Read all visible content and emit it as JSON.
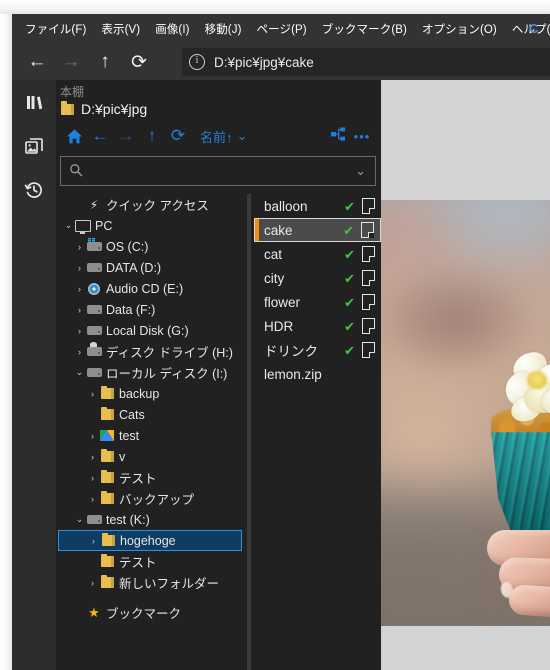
{
  "window": {
    "menu": [
      {
        "label": "ファイル(F)",
        "mnemonic": "F"
      },
      {
        "label": "表示(V)",
        "mnemonic": "V"
      },
      {
        "label": "画像(I)",
        "mnemonic": "I"
      },
      {
        "label": "移動(J)",
        "mnemonic": "J"
      },
      {
        "label": "ページ(P)",
        "mnemonic": "P"
      },
      {
        "label": "ブックマーク(B)",
        "mnemonic": "B"
      },
      {
        "label": "オプション(O)",
        "mnemonic": "O"
      },
      {
        "label": "ヘルプ(H)",
        "mnemonic": "H"
      }
    ],
    "logo_text": "C"
  },
  "addressbar": {
    "back_icon": "arrow-left-icon",
    "forward_icon": "arrow-right-icon",
    "up_icon": "arrow-up-icon",
    "reload_icon": "reload-icon",
    "info_icon": "info-icon",
    "path": "D:¥pic¥jpg¥cake",
    "back_glyph": "←",
    "forward_glyph": "→",
    "up_glyph": "↑",
    "reload_glyph": "⟳",
    "info_glyph": "i"
  },
  "rail": {
    "items": [
      {
        "name": "library-icon",
        "title": "本棚"
      },
      {
        "name": "images-icon",
        "title": "画像"
      },
      {
        "name": "history-icon",
        "title": "履歴"
      }
    ]
  },
  "browser": {
    "panel_title": "本棚",
    "breadcrumb": "D:¥pic¥jpg",
    "toolbar": {
      "home_glyph": "⌂",
      "back_glyph": "←",
      "forward_glyph": "→",
      "up_glyph": "↑",
      "refresh_glyph": "⟳",
      "sort_label": "名前↑",
      "sort_chevron": "⌄",
      "share_glyph": "⛗",
      "more_glyph": "•••"
    },
    "search": {
      "placeholder": "",
      "value": "",
      "magnifier_glyph": "⌕",
      "chevron_glyph": "⌄"
    },
    "tree": [
      {
        "label": "クイック アクセス",
        "icon": "bolt",
        "indent": 1,
        "twisty": "",
        "selected": false
      },
      {
        "label": "PC",
        "icon": "monitor",
        "indent": 0,
        "twisty": "⌄",
        "selected": false
      },
      {
        "label": "OS (C:)",
        "icon": "drive-os",
        "indent": 1,
        "twisty": "›",
        "selected": false
      },
      {
        "label": "DATA (D:)",
        "icon": "drive",
        "indent": 1,
        "twisty": "›",
        "selected": false
      },
      {
        "label": "Audio CD (E:)",
        "icon": "cd",
        "indent": 1,
        "twisty": "›",
        "selected": false
      },
      {
        "label": "Data (F:)",
        "icon": "drive",
        "indent": 1,
        "twisty": "›",
        "selected": false
      },
      {
        "label": "Local Disk (G:)",
        "icon": "drive",
        "indent": 1,
        "twisty": "›",
        "selected": false
      },
      {
        "label": "ディスク ドライブ (H:)",
        "icon": "drive-removable",
        "indent": 1,
        "twisty": "›",
        "selected": false
      },
      {
        "label": "ローカル ディスク (I:)",
        "icon": "drive",
        "indent": 1,
        "twisty": "⌄",
        "selected": false
      },
      {
        "label": "backup",
        "icon": "folder",
        "indent": 2,
        "twisty": "›",
        "selected": false
      },
      {
        "label": "Cats",
        "icon": "folder",
        "indent": 2,
        "twisty": "",
        "selected": false
      },
      {
        "label": "test",
        "icon": "gdrive",
        "indent": 2,
        "twisty": "›",
        "selected": false
      },
      {
        "label": "v",
        "icon": "folder",
        "indent": 2,
        "twisty": "›",
        "selected": false
      },
      {
        "label": "テスト",
        "icon": "folder",
        "indent": 2,
        "twisty": "›",
        "selected": false
      },
      {
        "label": "バックアップ",
        "icon": "folder",
        "indent": 2,
        "twisty": "›",
        "selected": false
      },
      {
        "label": "test (K:)",
        "icon": "drive",
        "indent": 1,
        "twisty": "⌄",
        "selected": false
      },
      {
        "label": "hogehoge",
        "icon": "folder",
        "indent": 2,
        "twisty": "›",
        "selected": true
      },
      {
        "label": "テスト",
        "icon": "folder",
        "indent": 2,
        "twisty": "",
        "selected": false
      },
      {
        "label": "新しいフォルダー",
        "icon": "folder",
        "indent": 2,
        "twisty": "›",
        "selected": false
      },
      {
        "label": "ブックマーク",
        "icon": "star",
        "indent": 1,
        "twisty": "",
        "selected": false
      }
    ],
    "files": [
      {
        "name": "balloon",
        "checked": true,
        "doc": true,
        "selected": false
      },
      {
        "name": "cake",
        "checked": true,
        "doc": true,
        "selected": true
      },
      {
        "name": "cat",
        "checked": true,
        "doc": true,
        "selected": false
      },
      {
        "name": "city",
        "checked": true,
        "doc": true,
        "selected": false
      },
      {
        "name": "flower",
        "checked": true,
        "doc": true,
        "selected": false
      },
      {
        "name": "HDR",
        "checked": true,
        "doc": true,
        "selected": false
      },
      {
        "name": "ドリンク",
        "checked": true,
        "doc": true,
        "selected": false
      },
      {
        "name": "lemon.zip",
        "checked": false,
        "doc": false,
        "selected": false
      }
    ],
    "check_glyph": "✔"
  },
  "viewer": {
    "alt": "cupcake-photo"
  },
  "colors": {
    "window_chrome": "#333333",
    "panel_bg": "#212121",
    "rail_bg": "#2d2d2d",
    "accent_blue": "#1f7fe0",
    "selection_blue": "#0f3c63",
    "selection_border": "#2f8fe0",
    "file_marker_orange": "#f0900a",
    "check_green": "#3ec43e",
    "folder_yellow": "#e8bf4e",
    "star_gold": "#f5b513",
    "text_primary": "#e9e9e9",
    "text_muted": "#8d8d8d",
    "viewer_bg": "#d3d3d3"
  }
}
